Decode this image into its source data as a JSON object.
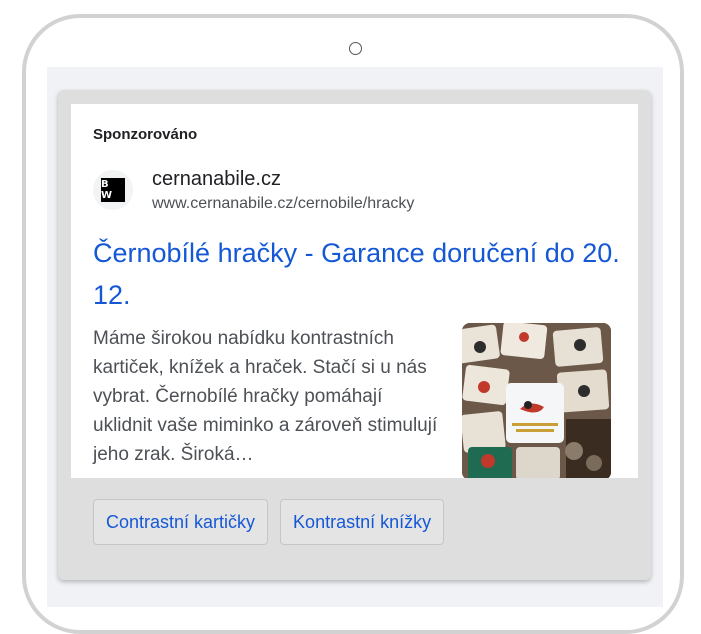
{
  "ad": {
    "sponsored_label": "Sponzorováno",
    "logo_text": "B W",
    "domain": "cernanabile.cz",
    "display_url": "www.cernanabile.cz/cernobile/hracky",
    "headline": "Černobílé hračky - Garance doručení do 20. 12.",
    "description": "Máme širokou nabídku kontrastních kartiček, knížek a hraček. Stačí si u nás vybrat. Černobílé hračky pomáhají uklidnit vaše miminko a zároveň stimulují jeho zrak. Široká…",
    "thumbnail_icon": "product-photo",
    "sitelinks": [
      {
        "label": "Contrastní kartičky"
      },
      {
        "label": "Kontrastní knížky"
      }
    ]
  },
  "colors": {
    "link": "#1558d6",
    "text": "#202124",
    "muted": "#4d5156"
  }
}
